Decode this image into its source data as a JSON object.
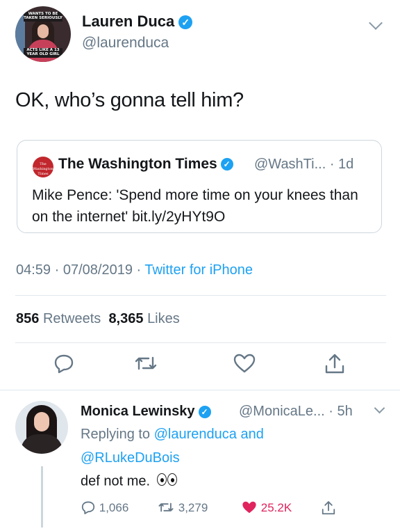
{
  "main_tweet": {
    "avatar_text_top": "WANTS TO BE TAKEN SERIOUSLY",
    "avatar_text_bottom": "ACTS LIKE A 13 YEAR OLD GIRL",
    "display_name": "Lauren Duca",
    "handle": "@laurenduca",
    "text": "OK, who’s gonna tell him?",
    "time": "04:59",
    "date": "07/08/2019",
    "source": "Twitter for iPhone",
    "retweets_count": "856",
    "retweets_label": "Retweets",
    "likes_count": "8,365",
    "likes_label": "Likes"
  },
  "quoted_tweet": {
    "logo_text": "The Washington Times",
    "display_name": "The Washington Times",
    "handle_time": "@WashTi... · 1d",
    "text": "Mike Pence: 'Spend more time on your knees than on the internet' bit.ly/2yHYt9O"
  },
  "reply": {
    "display_name": "Monica Lewinsky",
    "handle_time": "@MonicaLe... · 5h",
    "replying_prefix": "Replying to",
    "mention1": "@laurenduca",
    "and_word": "and",
    "mention2": "@RLukeDuBois",
    "text": "def not me.",
    "reply_count": "1,066",
    "retweet_count": "3,279",
    "like_count": "25.2K"
  },
  "icons": [
    "verified-badge-icon",
    "chevron-down-icon",
    "reply-icon",
    "retweet-icon",
    "like-icon",
    "share-icon",
    "eyes-emoji-icon"
  ],
  "colors": {
    "accent": "#1da1f2",
    "muted": "#657786",
    "like_red": "#e0245e",
    "border": "#ccd6dd"
  }
}
